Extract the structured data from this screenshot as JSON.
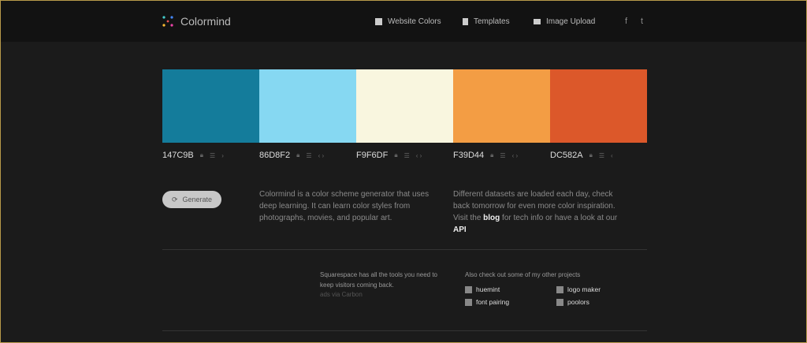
{
  "header": {
    "brand": "Colormind",
    "nav": [
      "Website Colors",
      "Templates",
      "Image Upload"
    ],
    "social": [
      "f",
      "t"
    ]
  },
  "palette": [
    {
      "hex": "#147C9B",
      "code": "147C9B",
      "arrows": "›"
    },
    {
      "hex": "#86D8F2",
      "code": "86D8F2",
      "arrows": "‹ ›"
    },
    {
      "hex": "#F9F6DF",
      "code": "F9F6DF",
      "arrows": "‹ ›"
    },
    {
      "hex": "#F39D44",
      "code": "F39D44",
      "arrows": "‹ ›"
    },
    {
      "hex": "#DC582A",
      "code": "DC582A",
      "arrows": "‹"
    }
  ],
  "generate_label": "Generate",
  "about": "Colormind is a color scheme generator that uses deep learning. It can learn color styles from photographs, movies, and popular art.",
  "datasets": {
    "text1": "Different datasets are loaded each day, check back tomorrow for even more color inspiration. Visit the ",
    "blog": "blog",
    "text2": " for tech info or have a look at our ",
    "api": "API"
  },
  "ad": {
    "text": "Squarespace has all the tools you need to keep visitors coming back.",
    "via": "ads via Carbon"
  },
  "projects": {
    "title": "Also check out some of my other projects",
    "items": [
      "huemint",
      "logo maker",
      "font pairing",
      "poolors"
    ]
  }
}
